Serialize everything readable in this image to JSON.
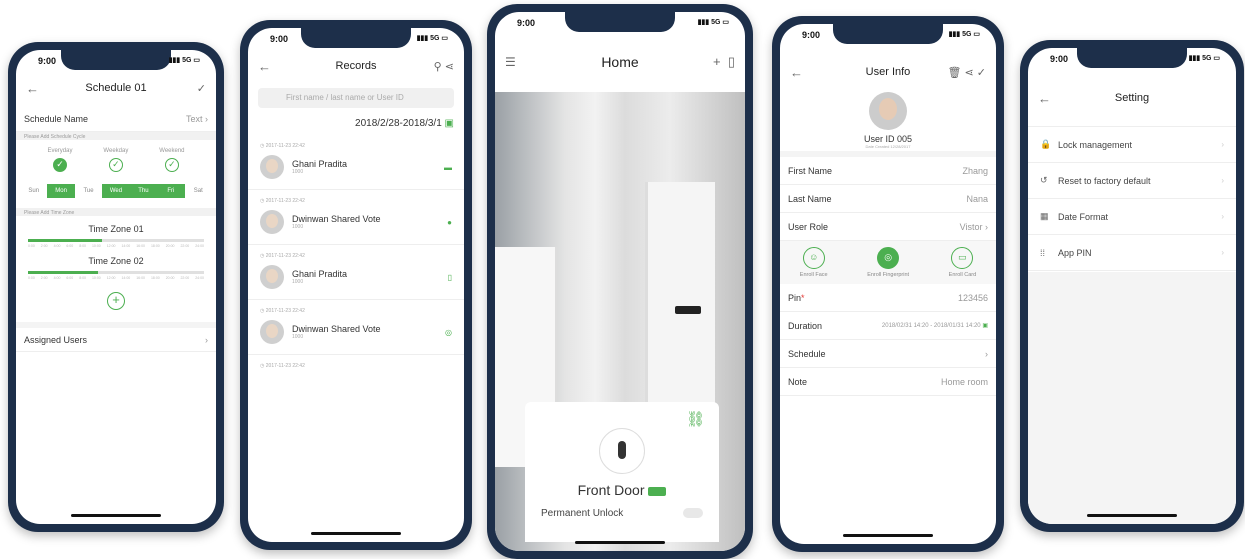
{
  "status": {
    "time": "9:00",
    "signal": "5G"
  },
  "schedule": {
    "title": "Schedule 01",
    "name_label": "Schedule Name",
    "name_value": "Text",
    "cycle_hint": "Please Add Schedule Cycle",
    "options": [
      {
        "label": "Everyday",
        "selected": true
      },
      {
        "label": "Weekday",
        "selected": false
      },
      {
        "label": "Weekend",
        "selected": false
      }
    ],
    "days": [
      {
        "label": "Sun",
        "on": false
      },
      {
        "label": "Mon",
        "on": true
      },
      {
        "label": "Tue",
        "on": false
      },
      {
        "label": "Wed",
        "on": true
      },
      {
        "label": "Thu",
        "on": true
      },
      {
        "label": "Fri",
        "on": true
      },
      {
        "label": "Sat",
        "on": false
      }
    ],
    "timezone_hint": "Please Add Time Zone",
    "timezones": [
      {
        "label": "Time Zone 01",
        "fill": 0.42
      },
      {
        "label": "Time Zone 02",
        "fill": 0.4
      }
    ],
    "assigned_label": "Assigned Users"
  },
  "records": {
    "title": "Records",
    "search_placeholder": "First name / last name or User ID",
    "date_range": "2018/2/28-2018/3/1",
    "items": [
      {
        "time": "2017-11-23 22:42",
        "name": "Ghani Pradita",
        "id": "1000",
        "icon": "card-icon"
      },
      {
        "time": "2017-11-23 22:42",
        "name": "Dwinwan Shared Vote",
        "id": "1000",
        "icon": "dot-icon"
      },
      {
        "time": "2017-11-23 22:42",
        "name": "Ghani Pradita",
        "id": "1000",
        "icon": "phone-icon"
      },
      {
        "time": "2017-11-23 22:42",
        "name": "Dwinwan Shared Vote",
        "id": "1000",
        "icon": "fingerprint-icon"
      }
    ],
    "last_time": "2017-11-23 22:42"
  },
  "home": {
    "title": "Home",
    "door_name": "Front Door",
    "permanent_unlock": "Permanent Unlock"
  },
  "user": {
    "title": "User Info",
    "user_id": "User ID 005",
    "created": "Date Created 12/28/2017",
    "first_name_label": "First Name",
    "first_name": "Zhang",
    "last_name_label": "Last Name",
    "last_name": "Nana",
    "role_label": "User Role",
    "role": "Vistor",
    "enroll": [
      {
        "label": "Enroll Face",
        "icon": "face-icon",
        "selected": false
      },
      {
        "label": "Enroll Fingerprint",
        "icon": "fingerprint-icon",
        "selected": true
      },
      {
        "label": "Enroll Card",
        "icon": "card-icon",
        "selected": false
      }
    ],
    "pin_label": "Pin",
    "pin": "123456",
    "duration_label": "Duration",
    "duration": "2018/02/31 14:20 - 2018/01/31 14:20",
    "schedule_label": "Schedule",
    "note_label": "Note",
    "note": "Home room"
  },
  "setting": {
    "title": "Setting",
    "items": [
      {
        "label": "Lock management",
        "icon": "lock-icon"
      },
      {
        "label": "Reset to factory default",
        "icon": "reset-icon"
      },
      {
        "label": "Date Format",
        "icon": "calendar-icon"
      },
      {
        "label": "App PIN",
        "icon": "keypad-icon"
      }
    ]
  },
  "colors": {
    "accent": "#4caf50",
    "frame": "#1d2f4a"
  }
}
